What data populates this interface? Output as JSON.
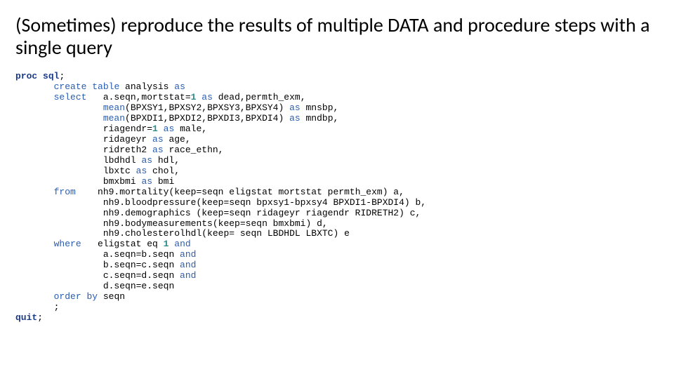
{
  "title": "(Sometimes) reproduce the results of multiple DATA and procedure steps with a single query",
  "code": {
    "l01a": "proc",
    "l01b": "sql",
    "l02a": "create",
    "l02b": "table",
    "l02c": " analysis ",
    "l02d": "as",
    "l03a": "select",
    "l03b": "   a.seqn,mortstat=",
    "l03c": "1",
    "l03d": " ",
    "l03e": "as",
    "l03f": " dead,permth_exm,",
    "l04a": "mean",
    "l04b": "(BPXSY1,BPXSY2,BPXSY3,BPXSY4) ",
    "l04c": "as",
    "l04d": " mnsbp,",
    "l05a": "mean",
    "l05b": "(BPXDI1,BPXDI2,BPXDI3,BPXDI4) ",
    "l05c": "as",
    "l05d": " mndbp,",
    "l06a": "riagendr=",
    "l06b": "1",
    "l06c": " ",
    "l06d": "as",
    "l06e": " male,",
    "l07a": "ridageyr ",
    "l07b": "as",
    "l07c": " age,",
    "l08a": "ridreth2 ",
    "l08b": "as",
    "l08c": " race_ethn,",
    "l09a": "lbdhdl ",
    "l09b": "as",
    "l09c": " hdl,",
    "l10a": "lbxtc ",
    "l10b": "as",
    "l10c": " chol,",
    "l11a": "bmxbmi ",
    "l11b": "as",
    "l11c": " bmi",
    "l12a": "from",
    "l12b": "    nh9.mortality(keep=seqn eligstat mortstat permth_exm) a,",
    "l13": "nh9.bloodpressure(keep=seqn bpxsy1-bpxsy4 BPXDI1-BPXDI4) b,",
    "l14": "nh9.demographics (keep=seqn ridageyr riagendr RIDRETH2) c,",
    "l15": "nh9.bodymeasurements(keep=seqn bmxbmi) d,",
    "l16": "nh9.cholesterolhdl(keep= seqn LBDHDL LBXTC) e",
    "l17a": "where",
    "l17b": "   eligstat eq ",
    "l17c": "1",
    "l17d": " ",
    "l17e": "and",
    "l18a": "a.seqn=b.seqn ",
    "l18b": "and",
    "l19a": "b.seqn=c.seqn ",
    "l19b": "and",
    "l20a": "c.seqn=d.seqn ",
    "l20b": "and",
    "l21": "d.seqn=e.seqn",
    "l22a": "order",
    "l22b": "by",
    "l22c": " seqn",
    "l23": ";",
    "l24": "quit"
  }
}
